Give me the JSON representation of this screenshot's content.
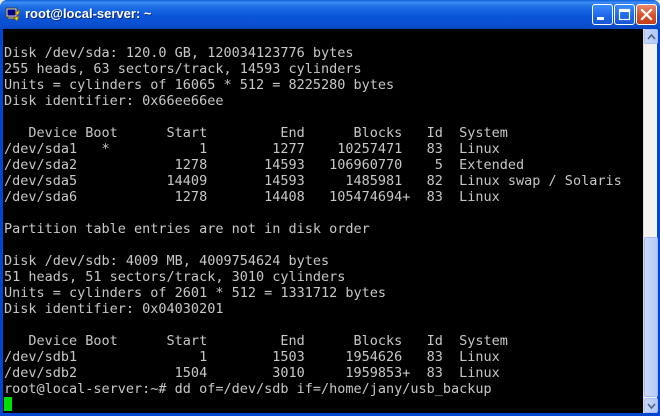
{
  "window": {
    "title": "root@local-server: ~",
    "app_icon": "putty-terminal-icon",
    "controls": [
      "minimize-icon",
      "maximize-icon",
      "close-icon"
    ]
  },
  "terminal": {
    "background": "#000000",
    "foreground": "#c8c8c8",
    "cursor_color": "#00e000",
    "lines": [
      "",
      "Disk /dev/sda: 120.0 GB, 120034123776 bytes",
      "255 heads, 63 sectors/track, 14593 cylinders",
      "Units = cylinders of 16065 * 512 = 8225280 bytes",
      "Disk identifier: 0x66ee66ee",
      "",
      "   Device Boot      Start         End      Blocks   Id  System",
      "/dev/sda1   *           1        1277    10257471   83  Linux",
      "/dev/sda2            1278       14593   106960770    5  Extended",
      "/dev/sda5           14409       14593     1485981   82  Linux swap / Solaris",
      "/dev/sda6            1278       14408   105474694+  83  Linux",
      "",
      "Partition table entries are not in disk order",
      "",
      "Disk /dev/sdb: 4009 MB, 4009754624 bytes",
      "51 heads, 51 sectors/track, 3010 cylinders",
      "Units = cylinders of 2601 * 512 = 1331712 bytes",
      "Disk identifier: 0x04030201",
      "",
      "   Device Boot      Start         End      Blocks   Id  System",
      "/dev/sdb1               1        1503     1954626   83  Linux",
      "/dev/sdb2            1504        3010     1959853+  83  Linux",
      "root@local-server:~# dd of=/dev/sdb if=/home/jany/usb_backup",
      ""
    ]
  },
  "scrollbar": {
    "up_icon": "scroll-up-arrow-icon",
    "down_icon": "scroll-down-arrow-icon",
    "position_fraction": 1.0
  }
}
